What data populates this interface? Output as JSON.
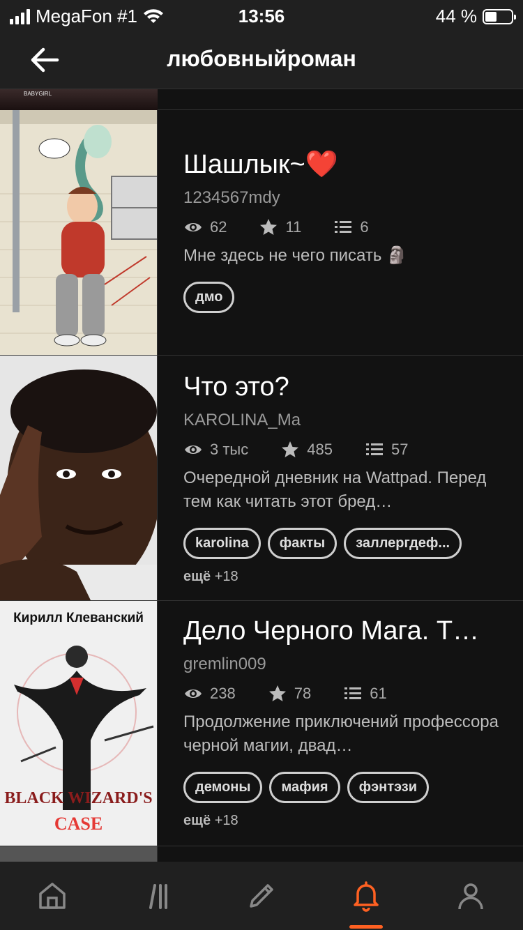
{
  "status_bar": {
    "carrier": "MegaFon #1",
    "time": "13:56",
    "battery_percent": "44 %",
    "battery_level": 0.44
  },
  "header": {
    "title": "любовныйроман"
  },
  "stories": [
    {
      "title": "Шашлык~❤️",
      "author": "1234567mdy",
      "views": "62",
      "votes": "11",
      "parts": "6",
      "description": "Мне здесь не чего писать 🗿",
      "tags": [
        "дмо"
      ],
      "more": ""
    },
    {
      "title": "Что это?",
      "author": "KAROLINA_Ma",
      "views": "3 тыс",
      "votes": "485",
      "parts": "57",
      "description": "Очередной дневник на Wattpad. Перед тем как читать этот бред…",
      "tags": [
        "karolina",
        "факты",
        "заллергдеф..."
      ],
      "more": "ещё",
      "more_count": "+18"
    },
    {
      "title": "Дело Черного Мага. Т…",
      "author": "gremlin009",
      "views": "238",
      "votes": "78",
      "parts": "61",
      "description": "Продолжение приключений профессора черной магии, двад…",
      "cover_top_text": "Кирилл Клеванский",
      "cover_bottom_text": "BLACK WIZARD'S",
      "cover_bottom_text2": "CASE",
      "tags": [
        "демоны",
        "мафия",
        "фэнтэзи"
      ],
      "more": "ещё",
      "more_count": "+18"
    }
  ],
  "colors": {
    "accent": "#ff6122",
    "background": "#121212",
    "bar": "#202020"
  },
  "tabbar": {
    "items": [
      "home-icon",
      "library-icon",
      "write-icon",
      "notifications-icon",
      "profile-icon"
    ],
    "active": "notifications-icon"
  }
}
